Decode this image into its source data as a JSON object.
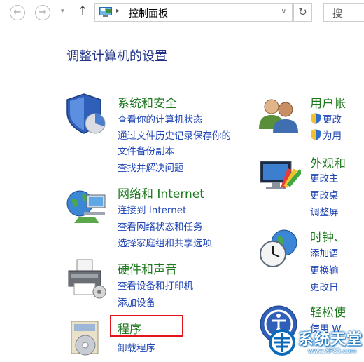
{
  "address_bar": {
    "back_glyph": "←",
    "forward_glyph": "→",
    "recent_glyph": "▾",
    "up_glyph": "↑",
    "separator_glyph": "▸",
    "path": "控制面板",
    "dropdown_glyph": "∨",
    "refresh_glyph": "↻",
    "search_placeholder": "搜"
  },
  "heading": "调整计算机的设置",
  "categories": [
    {
      "title": "系统和安全",
      "icon": "shield-pie-icon",
      "links": [
        "查看你的计算机状态",
        "通过文件历史记录保存你的",
        "文件备份副本",
        "查找并解决问题"
      ]
    },
    {
      "title": "网络和 Internet",
      "icon": "globe-network-icon",
      "links": [
        "连接到 Internet",
        "查看网络状态和任务",
        "选择家庭组和共享选项"
      ]
    },
    {
      "title": "硬件和声音",
      "icon": "printer-icon",
      "links": [
        "查看设备和打印机",
        "添加设备"
      ]
    },
    {
      "title": "程序",
      "icon": "programs-icon",
      "links": [
        "卸载程序"
      ]
    },
    {
      "title": "用户帐",
      "icon": "users-icon",
      "links": [
        "更改",
        "为用"
      ]
    },
    {
      "title": "外观和",
      "icon": "appearance-icon",
      "links": [
        "更改主",
        "更改桌",
        "调整屏"
      ]
    },
    {
      "title": "时钟、",
      "icon": "clock-globe-icon",
      "links": [
        "添加语",
        "更换输",
        "更改日"
      ]
    },
    {
      "title": "轻松使",
      "icon": "ease-of-access-icon",
      "links": [
        "使用 W"
      ]
    }
  ],
  "watermark": {
    "title": "系统天堂",
    "url": "www.XP85.com"
  },
  "colors": {
    "heading": "#1e3287",
    "category_title": "#1f7a1f",
    "link": "#1f45b5",
    "highlight_box": "#e4141c"
  }
}
